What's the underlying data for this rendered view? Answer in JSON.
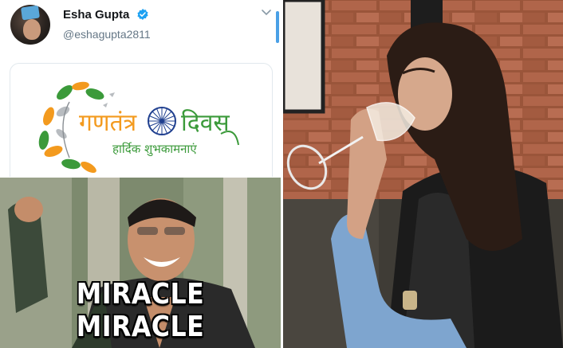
{
  "tweet": {
    "display_name": "Esha Gupta",
    "handle": "@eshagupta2811",
    "card": {
      "line1_left": "गणतंत्र",
      "line1_right": "दिवस",
      "line2": "हार्दिक शुभकामनाएं"
    }
  },
  "meme": {
    "caption": "MIRACLE MIRACLE"
  },
  "colors": {
    "verified": "#1da1f2",
    "saffron": "#f39a1e",
    "green": "#3b9a3a",
    "chakra": "#1f3f8f"
  }
}
